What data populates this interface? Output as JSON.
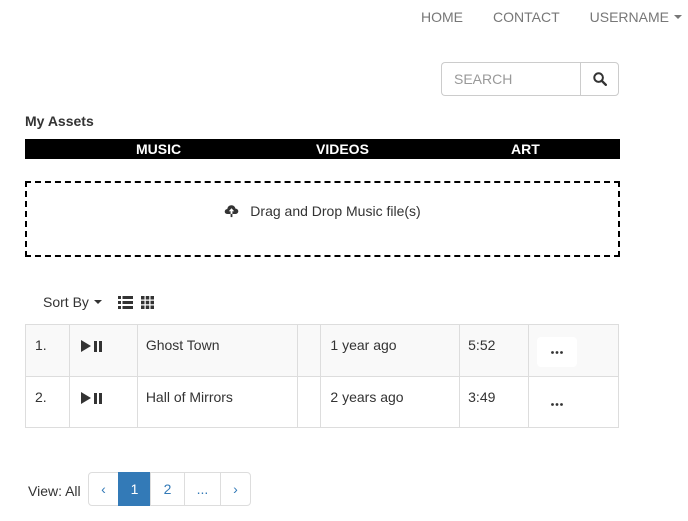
{
  "nav": {
    "home": "HOME",
    "contact": "CONTACT",
    "username": "USERNAME"
  },
  "search": {
    "placeholder": "SEARCH",
    "icon": "search-icon"
  },
  "heading": "My Assets",
  "categories": [
    "MUSIC",
    "VIDEOS",
    "ART"
  ],
  "dropzone": {
    "icon": "cloud-upload-icon",
    "text": "Drag and Drop Music file(s)"
  },
  "toolbar": {
    "sort_label": "Sort By",
    "view_icons": [
      "list-view-icon",
      "grid-view-icon"
    ]
  },
  "tracks": [
    {
      "num": "1.",
      "title": "Ghost Town",
      "date": "1 year ago",
      "duration": "5:52"
    },
    {
      "num": "2.",
      "title": "Hall of Mirrors",
      "date": "2 years ago",
      "duration": "3:49"
    }
  ],
  "more_label": "...",
  "pagination": {
    "view_label": "View: All",
    "prev": "‹",
    "pages": [
      "1",
      "2",
      "..."
    ],
    "next": "›",
    "active_page": "1"
  },
  "colors": {
    "accent": "#337ab7",
    "category_bar": "#000000",
    "nav_text": "#777777"
  }
}
